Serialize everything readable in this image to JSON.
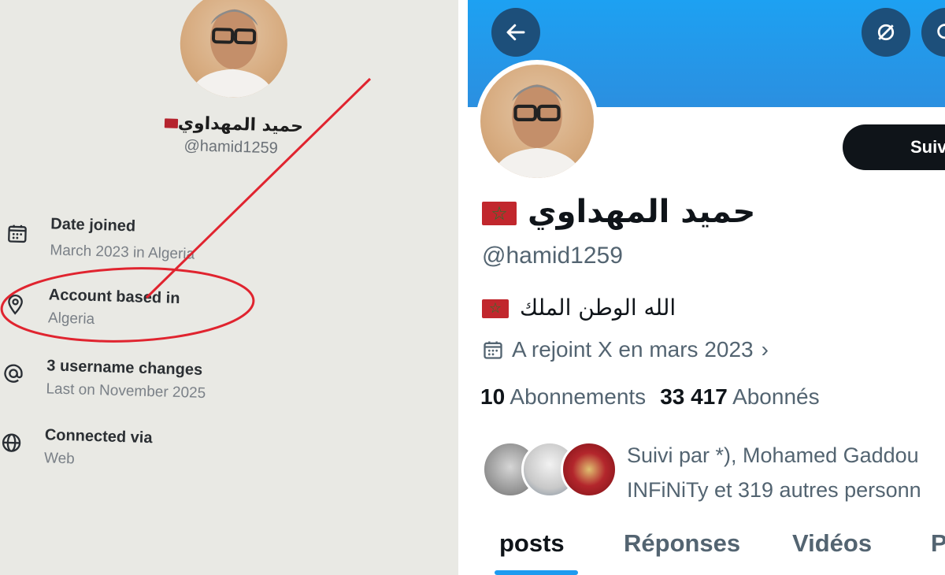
{
  "left_panel": {
    "display_name": "حميد المهداوي",
    "handle": "@hamid1259",
    "rows": [
      {
        "title": "Date joined",
        "subtitle": "March 2023 in Algeria",
        "icon": "calendar-icon"
      },
      {
        "title": "Account based in",
        "subtitle": "Algeria",
        "icon": "location-pin-icon"
      },
      {
        "title": "3 username changes",
        "subtitle": "Last on November 2025",
        "icon": "at-sign-icon"
      },
      {
        "title": "Connected via",
        "subtitle": "Web",
        "icon": "globe-icon"
      }
    ],
    "annotation_color": "#e0242f"
  },
  "right_panel": {
    "display_name": "حميد المهداوي",
    "handle": "@hamid1259",
    "bio": "الله الوطن الملك",
    "joined": "A rejoint X en mars 2023",
    "following_count": "10",
    "following_label": "Abonnements",
    "followers_count": "33 417",
    "followers_label": "Abonnés",
    "followed_by_line1": "Suivi par *), Mohamed Gaddou",
    "followed_by_line2": "INFiNiTy et 319 autres personn",
    "follow_button": "Suiv",
    "tabs": [
      "posts",
      "Réponses",
      "Vidéos",
      "P"
    ],
    "active_tab": "posts",
    "banner_color": "#1da1f2",
    "accent_color": "#1d9bf0",
    "flag_icon": "morocco-flag-icon"
  }
}
